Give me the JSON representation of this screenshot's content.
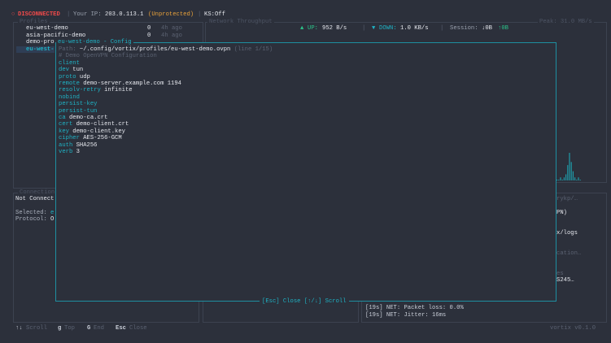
{
  "status": {
    "icon": "○",
    "state": "DISCONNECTED",
    "ip_label": "Your IP:",
    "ip": "203.0.113.1",
    "protection": "(Unprotected)",
    "killswitch": "KS:Off"
  },
  "profiles": {
    "title": "Profiles",
    "items": [
      {
        "name": "eu-west-demo",
        "count": "0",
        "age": "4h ago"
      },
      {
        "name": "asia-pacific-demo",
        "count": "0",
        "age": "4h ago"
      },
      {
        "name": "demo-pro",
        "count": "",
        "age": ""
      },
      {
        "name": "eu-west-",
        "count": "",
        "age": ""
      }
    ]
  },
  "throughput": {
    "title": "Network Throughput",
    "peak": "Peak: 31.0 MB/s",
    "up_icon": "▲",
    "up_label": "UP:",
    "up": "952 B/s",
    "down_icon": "▼",
    "down_label": "DOWN:",
    "down": "1.0 KB/s",
    "session_label": "Session:",
    "session_down": "↓0B",
    "session_up": "↑0B",
    "sparkline": [
      0,
      0,
      1,
      0,
      1,
      2,
      5,
      9,
      6,
      3,
      1,
      0,
      1,
      0
    ]
  },
  "connection": {
    "title": "Connection",
    "state": "Not Connect",
    "selected_label": "Selected:",
    "selected": "e",
    "protocol_label": "Protocol:",
    "protocol": "O"
  },
  "details_partial": [
    "rykp/…",
    "PN)",
    "x/logs",
    "cation…",
    "es",
    "S245…"
  ],
  "logs": [
    "[19s] NET: Packet loss: 0.0%",
    "[19s] NET: Jitter: 16ms"
  ],
  "config": {
    "title": "eu-west-demo - Config",
    "path_label": "Path:",
    "path": "~/.config/vortix/profiles/eu-west-demo.ovpn",
    "line_info": "(line 1/15)",
    "comment": "# Demo OpenVPN Configuration",
    "lines": [
      [
        "client",
        ""
      ],
      [
        "dev",
        "tun"
      ],
      [
        "proto",
        "udp"
      ],
      [
        "remote",
        "demo-server.example.com 1194"
      ],
      [
        "resolv-retry",
        "infinite"
      ],
      [
        "nobind",
        ""
      ],
      [
        "persist-key",
        ""
      ],
      [
        "persist-tun",
        ""
      ],
      [
        "ca",
        "demo-ca.crt"
      ],
      [
        "cert",
        "demo-client.crt"
      ],
      [
        "key",
        "demo-client.key"
      ],
      [
        "cipher",
        "AES-256-GCM"
      ],
      [
        "auth",
        "SHA256"
      ],
      [
        "verb",
        "3"
      ]
    ],
    "footer_close": "[Esc] Close",
    "footer_scroll": "[↑/↓] Scroll"
  },
  "footer": {
    "hints": [
      {
        "key": "↑↓",
        "label": "Scroll"
      },
      {
        "key": "g",
        "label": "Top"
      },
      {
        "key": "G",
        "label": "End"
      },
      {
        "key": "Esc",
        "label": "Close"
      }
    ],
    "version": "vortix v0.1.0"
  }
}
